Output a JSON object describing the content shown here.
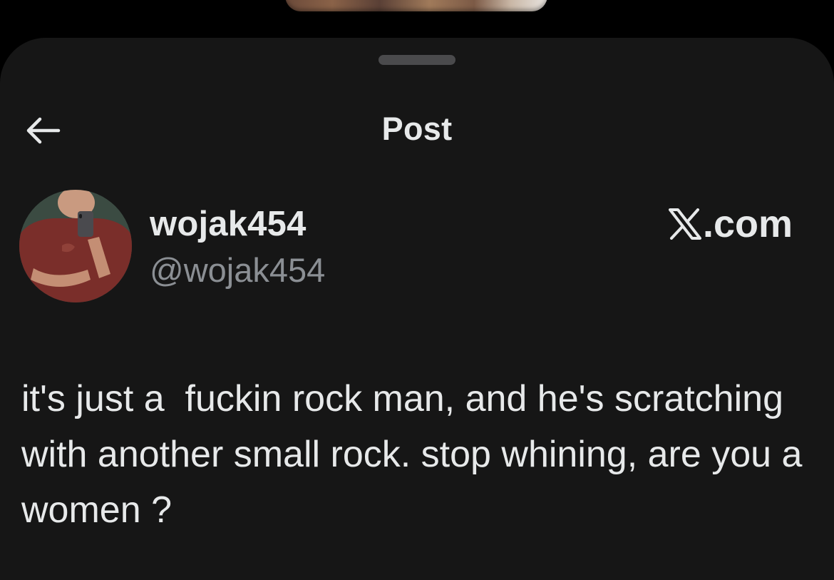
{
  "header": {
    "title": "Post",
    "back_icon": "arrow-left-icon"
  },
  "post": {
    "display_name": "wojak454",
    "handle": "@wojak454",
    "source": ".com",
    "source_icon": "x-logo-icon",
    "text": "it's just a  fuckin rock man, and he's scratching with another small rock. stop whining, are you a women ?"
  },
  "colors": {
    "background": "#000000",
    "sheet": "#161616",
    "primary_text": "#e7e9ea",
    "secondary_text": "#8b8f94",
    "grabber": "#4a4a4c"
  }
}
